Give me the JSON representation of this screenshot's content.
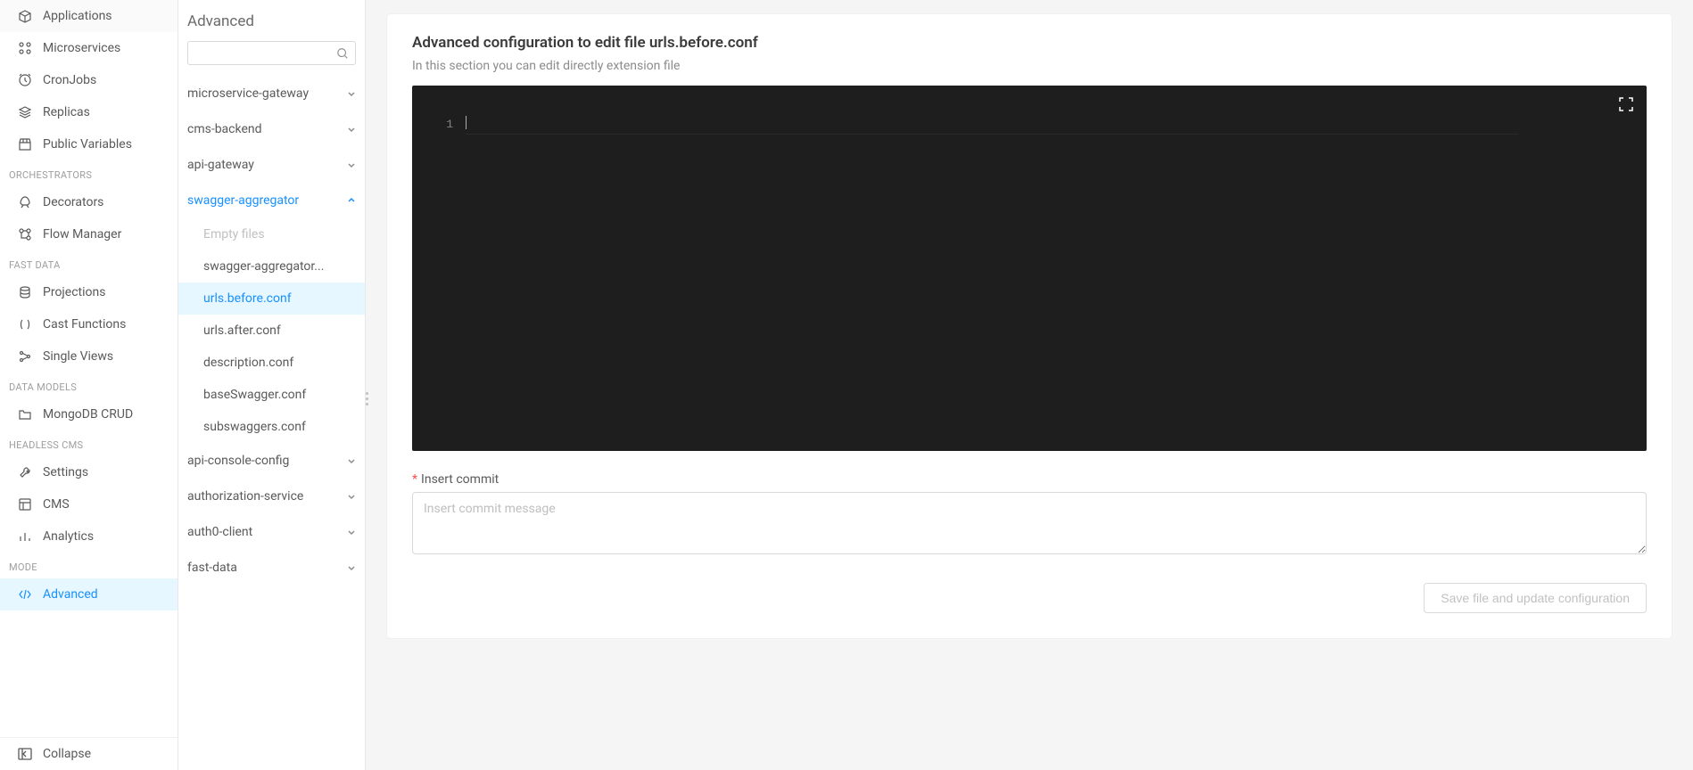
{
  "sidebar1": {
    "top_items": [
      {
        "id": "applications",
        "label": "Applications",
        "icon": "box"
      },
      {
        "id": "microservices",
        "label": "Microservices",
        "icon": "grid"
      },
      {
        "id": "cronjobs",
        "label": "CronJobs",
        "icon": "clock"
      },
      {
        "id": "replicas",
        "label": "Replicas",
        "icon": "layers"
      },
      {
        "id": "public-variables",
        "label": "Public Variables",
        "icon": "store"
      }
    ],
    "groups": [
      {
        "title": "ORCHESTRATORS",
        "items": [
          {
            "id": "decorators",
            "label": "Decorators",
            "icon": "rocket"
          },
          {
            "id": "flow-manager",
            "label": "Flow Manager",
            "icon": "flow"
          }
        ]
      },
      {
        "title": "FAST DATA",
        "items": [
          {
            "id": "projections",
            "label": "Projections",
            "icon": "db"
          },
          {
            "id": "cast-functions",
            "label": "Cast Functions",
            "icon": "parens"
          },
          {
            "id": "single-views",
            "label": "Single Views",
            "icon": "views"
          }
        ]
      },
      {
        "title": "DATA MODELS",
        "items": [
          {
            "id": "mongodb-crud",
            "label": "MongoDB CRUD",
            "icon": "folder"
          }
        ]
      },
      {
        "title": "HEADLESS CMS",
        "items": [
          {
            "id": "settings",
            "label": "Settings",
            "icon": "wrench"
          },
          {
            "id": "cms",
            "label": "CMS",
            "icon": "layout"
          },
          {
            "id": "analytics",
            "label": "Analytics",
            "icon": "bars"
          }
        ]
      },
      {
        "title": "MODE",
        "items": [
          {
            "id": "advanced",
            "label": "Advanced",
            "icon": "code",
            "active": true
          }
        ]
      }
    ],
    "collapse_label": "Collapse"
  },
  "sidebar2": {
    "title": "Advanced",
    "search_placeholder": "",
    "tree": [
      {
        "id": "microservice-gateway",
        "label": "microservice-gateway",
        "expanded": false
      },
      {
        "id": "cms-backend",
        "label": "cms-backend",
        "expanded": false
      },
      {
        "id": "api-gateway",
        "label": "api-gateway",
        "expanded": false
      },
      {
        "id": "swagger-aggregator",
        "label": "swagger-aggregator",
        "expanded": true,
        "children": [
          {
            "id": "empty-files",
            "label": "Empty files",
            "disabled": true
          },
          {
            "id": "swagger-aggregator-file",
            "label": "swagger-aggregator..."
          },
          {
            "id": "urls-before",
            "label": "urls.before.conf",
            "active": true
          },
          {
            "id": "urls-after",
            "label": "urls.after.conf"
          },
          {
            "id": "description",
            "label": "description.conf"
          },
          {
            "id": "base-swagger",
            "label": "baseSwagger.conf"
          },
          {
            "id": "subswaggers",
            "label": "subswaggers.conf"
          }
        ]
      },
      {
        "id": "api-console-config",
        "label": "api-console-config",
        "expanded": false
      },
      {
        "id": "authorization-service",
        "label": "authorization-service",
        "expanded": false
      },
      {
        "id": "auth0-client",
        "label": "auth0-client",
        "expanded": false
      },
      {
        "id": "fast-data",
        "label": "fast-data",
        "expanded": false
      }
    ]
  },
  "main": {
    "title": "Advanced configuration to edit file urls.before.conf",
    "subtitle": "In this section you can edit directly extension file",
    "editor": {
      "line_no": "1",
      "content": ""
    },
    "commit": {
      "label": "Insert commit",
      "required": "*",
      "placeholder": "Insert commit message"
    },
    "save_label": "Save file and update configuration"
  }
}
